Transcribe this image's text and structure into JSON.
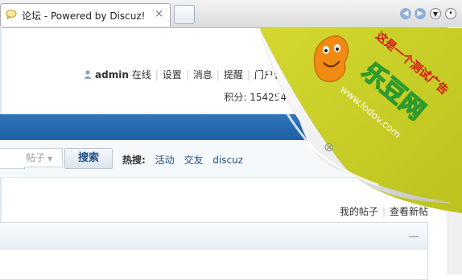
{
  "browser": {
    "tab_title": "论坛 - Powered by Discuz!",
    "tab_close": "×",
    "back_glyph": "◀",
    "forward_glyph": "▶",
    "menu_glyph": "▼"
  },
  "userbar": {
    "username": "admin",
    "status": "在线",
    "links": [
      "设置",
      "消息",
      "提醒",
      "门户管理"
    ]
  },
  "credits": {
    "label": "积分: 154254",
    "arrow": "▼"
  },
  "search": {
    "type": "帖子",
    "button": "搜索",
    "hot_label": "热搜:",
    "hot_tags": [
      "活动",
      "交友",
      "discuz"
    ]
  },
  "quick_links": [
    "我的帖子",
    "查看新帖"
  ],
  "panel": {
    "collapse": "—"
  },
  "ad": {
    "slogan": "这是一个测试广告",
    "brand": "乐豆网",
    "url": "www.lodov.com",
    "close": "⊗",
    "colors": {
      "peel": "#c9ce26",
      "slogan": "#d41313",
      "brand": "#2e9a2e",
      "bean": "#f08a12"
    }
  },
  "colors": {
    "navbar": "#2469b1",
    "link": "#1f4e84"
  }
}
